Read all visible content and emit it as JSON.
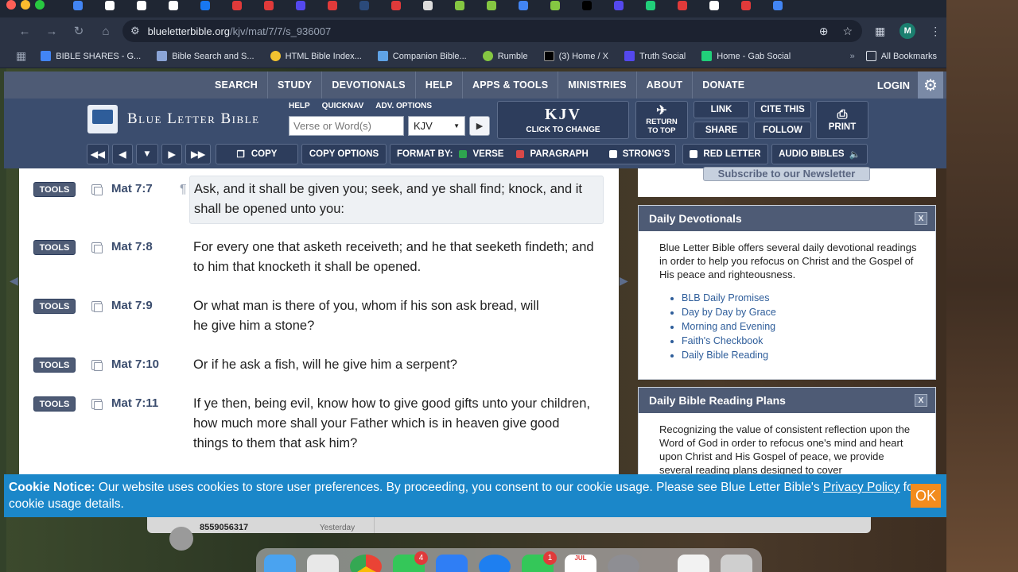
{
  "browser": {
    "url_host": "blueletterbible.org",
    "url_path": "/kjv/mat/7/7/s_936007",
    "bookmarks": [
      {
        "label": "BIBLE SHARES - G...",
        "color": "#4285f4"
      },
      {
        "label": "Bible Search and S...",
        "color": "#8aa4d6"
      },
      {
        "label": "HTML Bible Index...",
        "color": "#f2c230"
      },
      {
        "label": "Companion Bible...",
        "color": "#5fa3e6"
      },
      {
        "label": "Rumble",
        "color": "#85c742"
      },
      {
        "label": "(3) Home / X",
        "color": "#000000"
      },
      {
        "label": "Truth Social",
        "color": "#5448ee"
      },
      {
        "label": "Home - Gab Social",
        "color": "#21cf7a"
      }
    ],
    "all_bookmarks": "All Bookmarks",
    "profile_initial": "M"
  },
  "site_nav": {
    "items": [
      "SEARCH",
      "STUDY",
      "DEVOTIONALS",
      "HELP",
      "APPS & TOOLS",
      "MINISTRIES",
      "ABOUT",
      "DONATE"
    ],
    "login": "LOGIN"
  },
  "header": {
    "logo": "Blue Letter Bible",
    "links": [
      "HELP",
      "QUICKNAV",
      "ADV. OPTIONS"
    ],
    "search_placeholder": "Verse or Word(s)",
    "version": "KJV",
    "version_big": "KJV",
    "version_hint": "CLICK TO CHANGE",
    "return_label": "RETURN TO TOP",
    "link": "LINK",
    "cite": "CITE THIS",
    "share": "SHARE",
    "follow": "FOLLOW",
    "print": "PRINT"
  },
  "toolbar": {
    "copy": "COPY",
    "copy_options": "COPY OPTIONS",
    "format_by": "FORMAT BY:",
    "verse": "VERSE",
    "paragraph": "PARAGRAPH",
    "strongs": "STRONG'S",
    "red_letter": "RED LETTER",
    "audio": "AUDIO BIBLES"
  },
  "verses": [
    {
      "tools": "TOOLS",
      "ref": "Mat 7:7",
      "text": "Ask, and it shall be given you; seek, and ye shall find; knock, and it shall be opened unto you:"
    },
    {
      "tools": "TOOLS",
      "ref": "Mat 7:8",
      "text": "For every one that asketh receiveth; and he that seeketh findeth; and to him that knocketh it shall be opened."
    },
    {
      "tools": "TOOLS",
      "ref": "Mat 7:9",
      "text": "Or what man is there of you, whom if his son ask bread, will he give him a stone?"
    },
    {
      "tools": "TOOLS",
      "ref": "Mat 7:10",
      "text": "Or if he ask a fish, will he give him a serpent?"
    },
    {
      "tools": "TOOLS",
      "ref": "Mat 7:11",
      "text": "If ye then, being evil, know how to give good gifts unto your children, how much more shall your Father which is in heaven give good things to them that ask him?"
    }
  ],
  "sidebar": {
    "subscribe": "Subscribe to our Newsletter",
    "devotionals": {
      "title": "Daily Devotionals",
      "close": "X",
      "body": "Blue Letter Bible offers several daily devotional readings in order to help you refocus on Christ and the Gospel of His peace and righteousness.",
      "links": [
        "BLB Daily Promises",
        "Day by Day by Grace",
        "Morning and Evening",
        "Faith's Checkbook",
        "Daily Bible Reading"
      ]
    },
    "reading_plans": {
      "title": "Daily Bible Reading Plans",
      "close": "X",
      "body": "Recognizing the value of consistent reflection upon the Word of God in order to refocus one's mind and heart upon Christ and His Gospel of peace, we provide several reading plans designed to cover"
    }
  },
  "cookie": {
    "heading": "Cookie Notice:",
    "text_before": " Our website uses cookies to store user preferences. By proceeding, you consent to our cookie usage. Please see Blue Letter Bible's ",
    "link": "Privacy Policy",
    "text_after": " for cookie usage details.",
    "ok": "OK"
  },
  "messages_peek": {
    "number": "8559056317",
    "date": "Yesterday"
  },
  "dock": {
    "messages_badge": "4",
    "facetime_badge": "1",
    "calendar_month": "JUL"
  }
}
